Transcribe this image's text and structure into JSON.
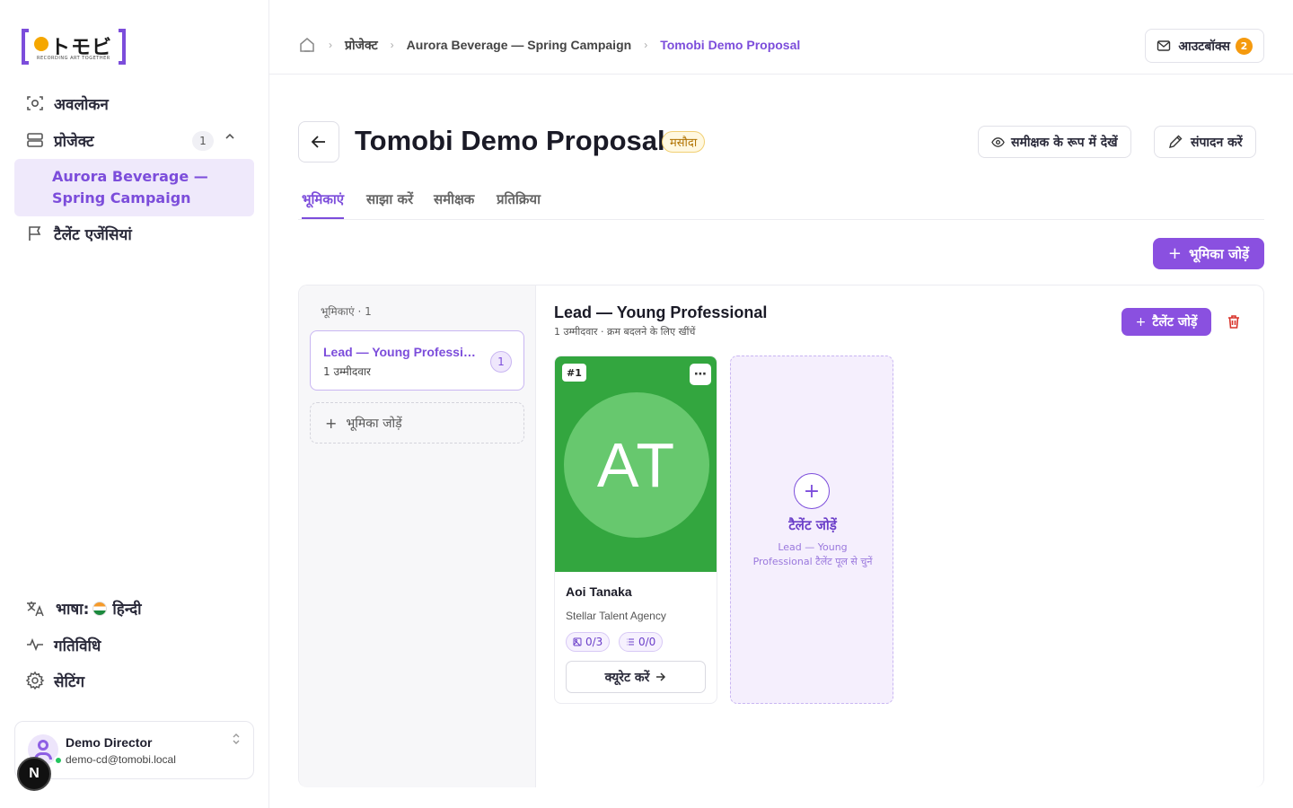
{
  "brand": {
    "logo_text": "トモビ",
    "tagline": "RECORDING ART TOGETHER"
  },
  "sidebar": {
    "items": [
      {
        "label": "अवलोकन",
        "icon": "scan-icon"
      },
      {
        "label": "प्रोजेक्ट",
        "icon": "layers-icon",
        "badge": "1"
      },
      {
        "label": "टैलेंट एजेंसियां",
        "icon": "flag-icon"
      }
    ],
    "subitem": "Aurora Beverage — Spring Campaign",
    "language_label": "भाषा:",
    "language_value": "हिन्दी",
    "activity": "गतिविधि",
    "settings": "सेटिंग"
  },
  "user": {
    "name": "Demo Director",
    "email": "demo-cd@tomobi.local"
  },
  "next_badge": "N",
  "breadcrumb": {
    "project": "प्रोजेक्ट",
    "campaign": "Aurora Beverage — Spring Campaign",
    "current": "Tomobi Demo Proposal"
  },
  "outbox": {
    "label": "आउटबॉक्स",
    "count": "2"
  },
  "header": {
    "title": "Tomobi Demo Proposal",
    "status": "मसौदा",
    "view_as_reviewer": "समीक्षक के रूप में देखें",
    "edit": "संपादन करें"
  },
  "tabs": [
    "भूमिकाएं",
    "साझा करें",
    "समीक्षक",
    "प्रतिक्रिया"
  ],
  "add_role_button": "भूमिका जोड़ें",
  "roles_panel": {
    "heading": "भूमिकाएं · 1",
    "role": {
      "name": "Lead — Young Professional",
      "sub": "1 उम्मीदवार",
      "count": "1"
    },
    "add_role": "भूमिका जोड़ें"
  },
  "role_detail": {
    "title": "Lead — Young Professional",
    "meta": "1 उम्मीदवार · क्रम बदलने के लिए खींचें",
    "add_talent": "टैलेंट जोड़ें"
  },
  "talent": {
    "rank": "#1",
    "initials": "AT",
    "name": "Aoi Tanaka",
    "agency": "Stellar Talent Agency",
    "photos": "0/3",
    "lists": "0/0",
    "curate": "क्यूरेट करें"
  },
  "add_slot": {
    "label": "टैलेंट जोड़ें",
    "hint": "Lead — Young Professional टैलेंट पूल से चुनें"
  },
  "colors": {
    "accent": "#7c4ddb",
    "talent_bg": "#33a63f",
    "badge_orange": "#f59a0e"
  }
}
